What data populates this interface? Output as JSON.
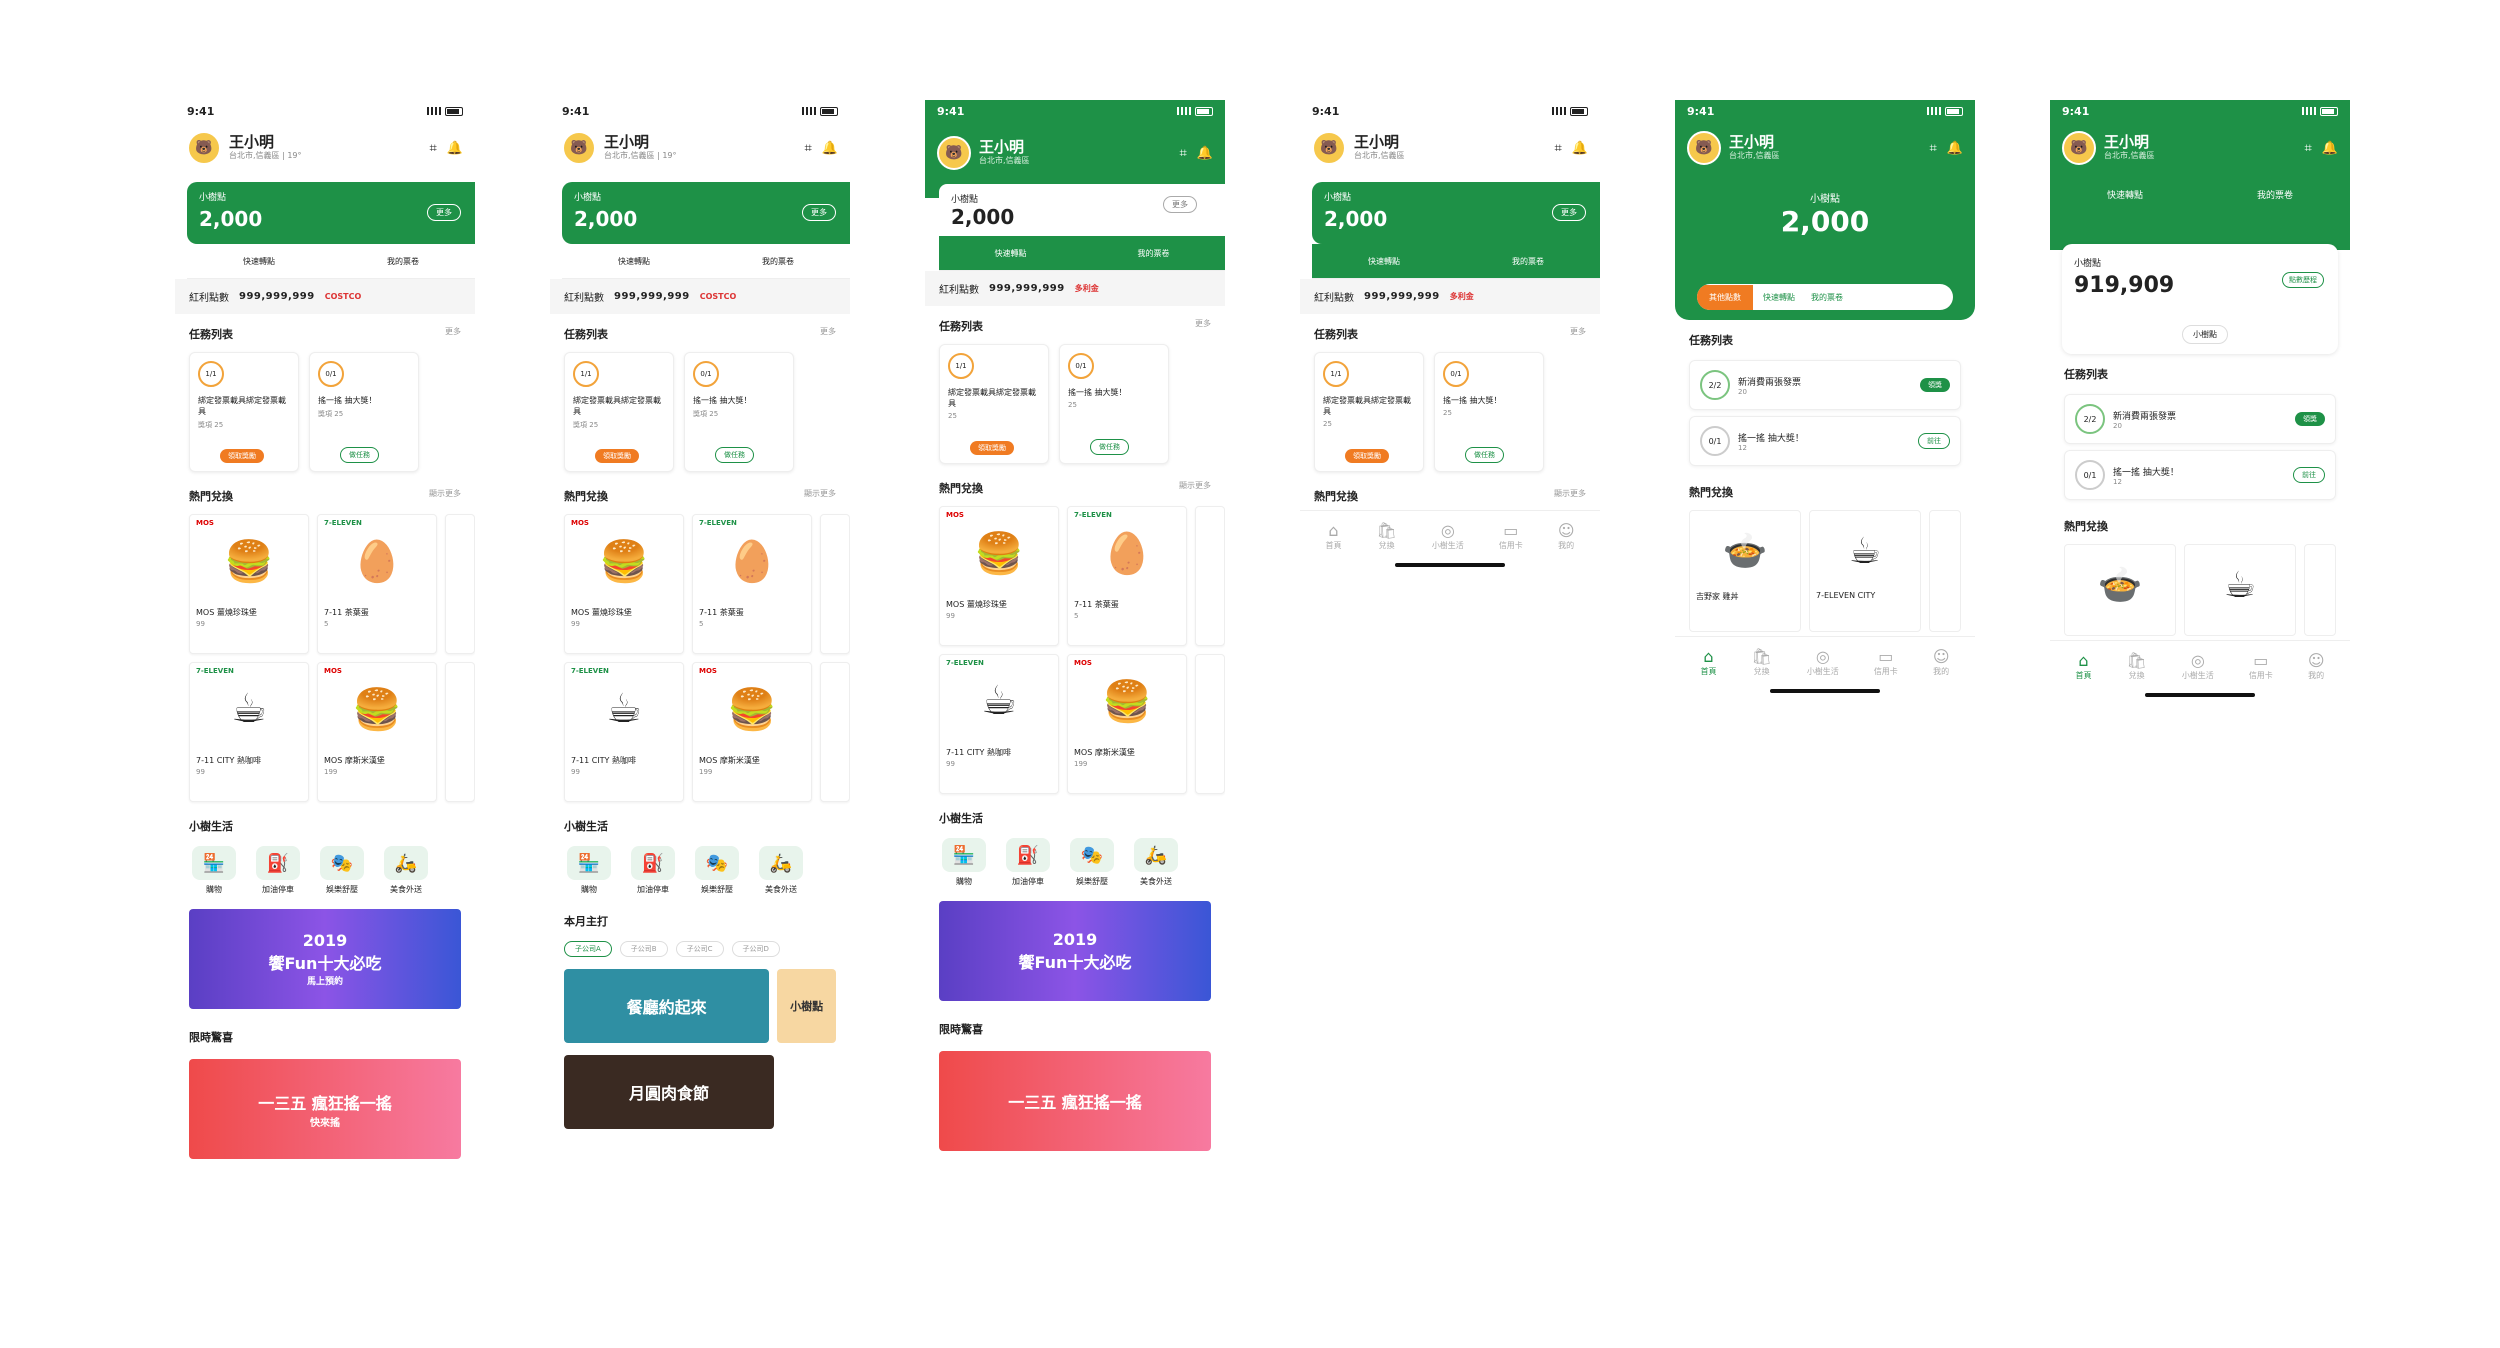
{
  "status": {
    "time": "9:41"
  },
  "user": {
    "name": "王小明",
    "location": "台北市,信義區",
    "weather": "19°"
  },
  "points": {
    "label": "小樹點",
    "value": "2,000",
    "more": "更多",
    "big_value": "919,909",
    "history": "點數歷程"
  },
  "quick": {
    "transfer": "快速轉點",
    "coupons": "我的票卷",
    "other": "其他點數"
  },
  "info": {
    "bonus_label": "紅利點數",
    "bonus_value": "999,999,999",
    "costco": "COSTCO",
    "costco_label": "多利金"
  },
  "tasks": {
    "title": "任務列表",
    "more": "更多",
    "items": [
      {
        "progress": "1/1",
        "title": "綁定發票載具綁定發票載具",
        "reward": "獎項",
        "points": "25",
        "button": "領取獎勵"
      },
      {
        "progress": "0/1",
        "title": "搖一搖 抽大獎！",
        "reward": "獎項",
        "points": "25",
        "button": "做任務"
      }
    ],
    "missions": [
      {
        "progress": "2/2",
        "title": "新消費兩張發票",
        "reward": "獎項",
        "points": "20",
        "button": "領獎"
      },
      {
        "progress": "0/1",
        "title": "搖一搖 抽大獎！",
        "reward": "獎項",
        "points": "12",
        "button": "前往"
      }
    ]
  },
  "exchange": {
    "title": "熱門兌換",
    "more": "顯示更多",
    "items": [
      {
        "brand": "MOS",
        "name": "MOS 薑燒珍珠堡",
        "points": "99",
        "icon": "🍔"
      },
      {
        "brand": "7-ELEVEN",
        "name": "7-11 茶葉蛋",
        "points": "5",
        "icon": "🥚"
      },
      {
        "brand": "7-ELEVEN",
        "name": "7-11 CITY 熱咖啡",
        "points": "99",
        "icon": "☕"
      },
      {
        "brand": "MOS",
        "name": "MOS 摩斯米漢堡",
        "points": "199",
        "icon": "🍔"
      }
    ],
    "extra": [
      {
        "brand": "吉野家",
        "name": "吉野家 雞丼",
        "icon": "🍲"
      },
      {
        "brand": "7-ELEVEN",
        "name": "7-ELEVEN CITY",
        "icon": "☕"
      }
    ]
  },
  "life": {
    "title": "小樹生活",
    "items": [
      {
        "label": "購物",
        "icon": "🏪"
      },
      {
        "label": "加油停車",
        "icon": "⛽"
      },
      {
        "label": "娛樂舒壓",
        "icon": "🎭"
      },
      {
        "label": "美食外送",
        "icon": "🛵"
      }
    ]
  },
  "banners": {
    "b1_year": "2019",
    "b1_title": "饗Fun十大必吃",
    "b1_sub": "馬上預約",
    "limited": "限時驚喜",
    "b2_title": "一三五 瘋狂搖一搖",
    "b2_sub": "快來搖"
  },
  "monthly": {
    "title": "本月主打",
    "pills": [
      "子公司A",
      "子公司B",
      "子公司C",
      "子公司D"
    ],
    "feature1": "餐廳約起來",
    "feature2": "月圓肉食節",
    "feature3": "小樹點"
  },
  "tabbar": [
    {
      "label": "首頁",
      "icon": "⌂"
    },
    {
      "label": "兌換",
      "icon": "🛍"
    },
    {
      "label": "小樹生活",
      "icon": "◎"
    },
    {
      "label": "信用卡",
      "icon": "▭"
    },
    {
      "label": "我的",
      "icon": "☺"
    }
  ],
  "colors": {
    "brand": "#1e9147",
    "accent": "#f07b22"
  }
}
